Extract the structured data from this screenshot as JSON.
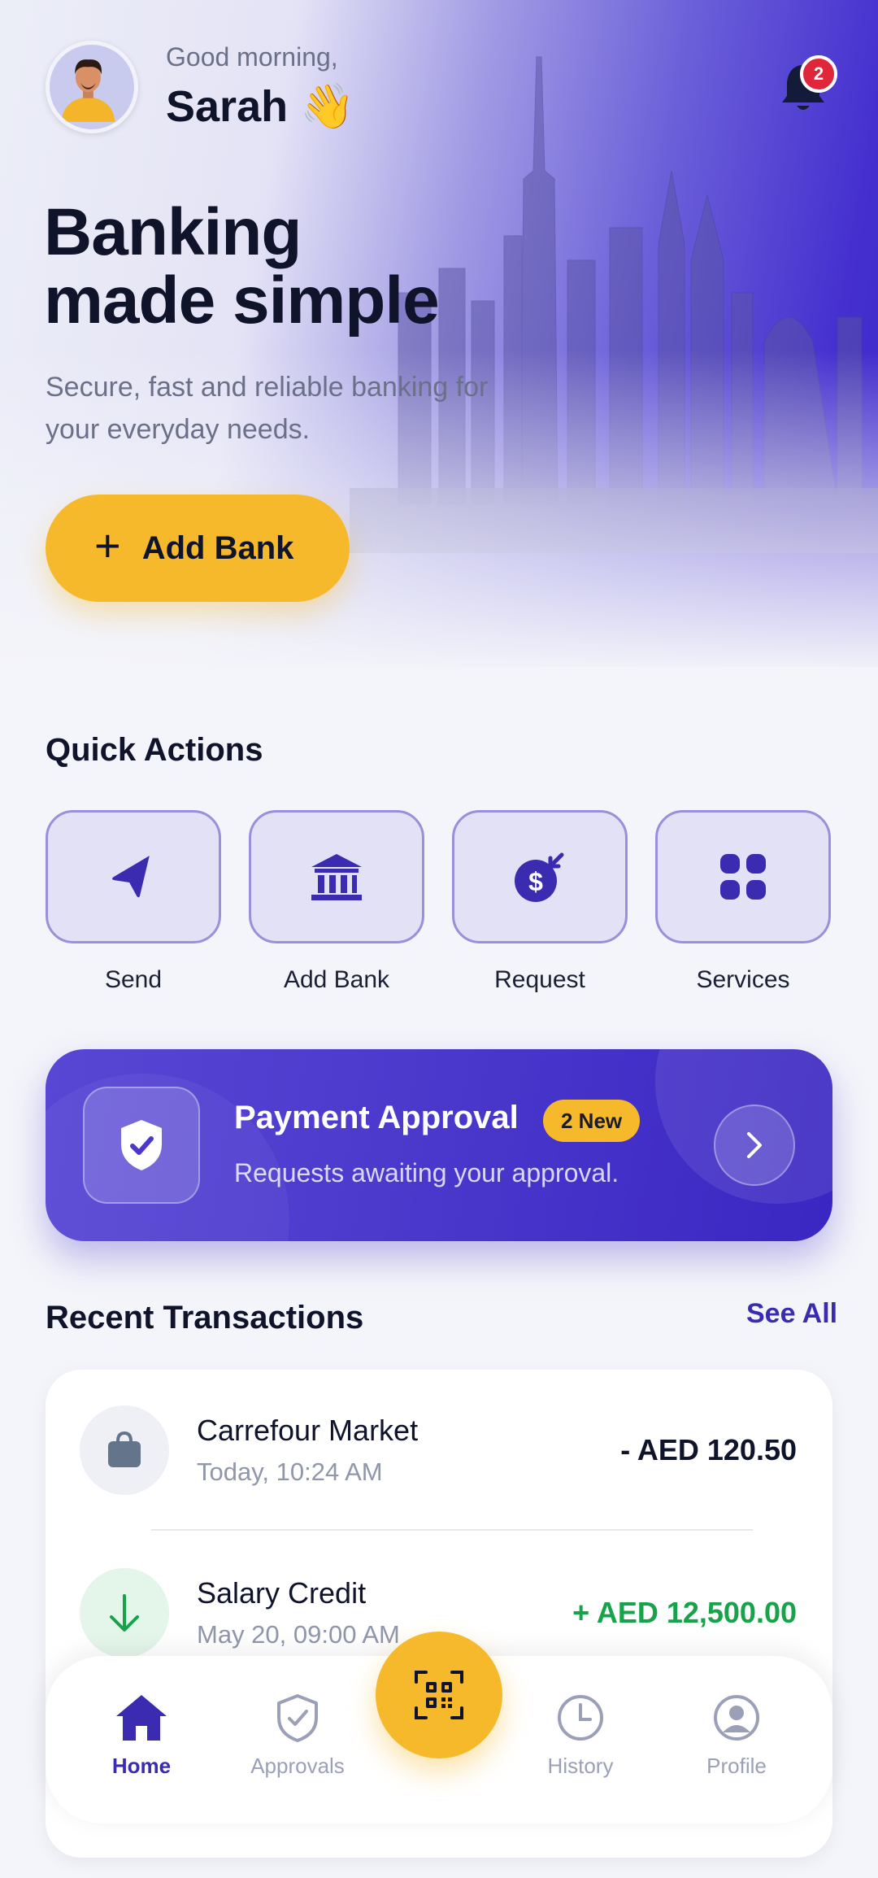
{
  "header": {
    "greeting": "Good morning,",
    "user_name": "Sarah 👋",
    "notification_count": "2"
  },
  "hero": {
    "title_line1": "Banking",
    "title_line2": "made simple",
    "subtitle_line1": "Secure, fast and reliable banking for",
    "subtitle_line2": "your everyday needs.",
    "cta_label": "Add Bank"
  },
  "quick_actions": {
    "title": "Quick Actions",
    "items": [
      {
        "label": "Send",
        "icon": "send-icon"
      },
      {
        "label": "Add Bank",
        "icon": "bank-icon"
      },
      {
        "label": "Request",
        "icon": "request-money-icon"
      },
      {
        "label": "Services",
        "icon": "grid-icon"
      }
    ]
  },
  "approval": {
    "title": "Payment Approval",
    "badge": "2 New",
    "subtitle": "Requests awaiting your approval."
  },
  "transactions": {
    "title": "Recent Transactions",
    "see_all": "See All",
    "items": [
      {
        "name": "Carrefour Market",
        "time": "Today, 10:24 AM",
        "amount": "- AED 120.50",
        "icon": "shopping-bag-icon"
      },
      {
        "name": "Salary Credit",
        "time": "May 20, 09:00 AM",
        "amount": "+ AED 12,500.00",
        "icon": "arrow-down-icon"
      }
    ]
  },
  "bottom_nav": {
    "items": [
      {
        "label": "Home",
        "icon": "home-icon",
        "active": true
      },
      {
        "label": "Approvals",
        "icon": "shield-check-icon",
        "active": false
      },
      {
        "label": "History",
        "icon": "clock-icon",
        "active": false
      },
      {
        "label": "Profile",
        "icon": "user-icon",
        "active": false
      }
    ],
    "center_action": "qr-scan-icon"
  },
  "colors": {
    "primary": "#4a38cc",
    "accent": "#f6b92b",
    "text": "#10142b",
    "muted": "#6b7089",
    "positive": "#16a34a",
    "danger": "#e0263a"
  }
}
